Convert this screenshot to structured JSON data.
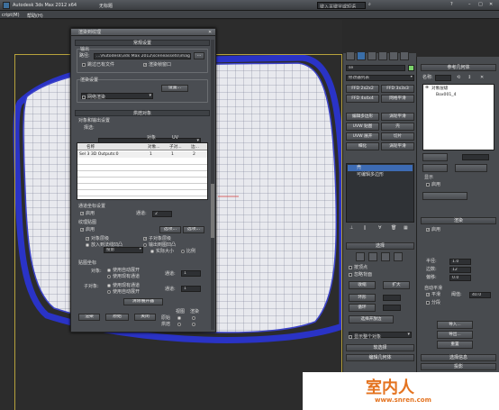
{
  "titlebar": {
    "app_title": "Autodesk 3ds Max  2012 x64",
    "doc_title": "无标题",
    "search_placeholder": "键入关键字或短语"
  },
  "menubar": {
    "items": [
      "cript(M)",
      "帮助(H)"
    ]
  },
  "dialog": {
    "title": "渲染到纹理",
    "general": {
      "header": "常规设置",
      "output_label": "输出",
      "path_label": "路径:",
      "path_value": "...\\Autodesk\\3ds Max 2012\\sceneassets\\images\\",
      "browse_label": "...",
      "skip_existing": "跳过已有文件",
      "show_frame_window": "渲染帧窗口",
      "render_settings_label": "渲染设置",
      "preset_value": "",
      "setup_button": "设置...",
      "network_render": "网络渲染"
    },
    "baked_object": {
      "header": "烘焙对象",
      "projection_label": "对象和输出设置",
      "selection_label": "择选:",
      "columns": [
        "名称",
        "对象...",
        "子对...",
        "边..."
      ],
      "subheaders": [
        "对象",
        "UV"
      ],
      "row": [
        "Sel 3 3D Outputs:0",
        "1",
        "1",
        "2"
      ]
    },
    "mapping": {
      "channel_label": "通道坐标设置",
      "enable": "启用",
      "channel_name": "通道:",
      "channel_value": "2",
      "auto_unwrap_label": "纹理贴图",
      "use_existing": "启用",
      "projection_value": "投影",
      "options_button": "选项...",
      "options_button2": "选项...",
      "object_level": "对象层级",
      "sub_object_level": "子对象层级",
      "put_to_normal": "放入到法线凹凸",
      "put_to_bump": "输出到图凹凸",
      "actual_size": "实际大小",
      "proportional": "比例"
    },
    "render": {
      "header": "贴图坐标",
      "object_label": "对象:",
      "sub_object_label": "子对象:",
      "use_auto_unwrap": "使用自动展开",
      "use_existing_channel": "使用现有通道",
      "use_existing_channel2": "使用现有通道",
      "use_auto_unwrap2": "使用自动展开",
      "channel_label": "通道:",
      "channel_value": "1",
      "clear_unwrap_button": "清除展开器",
      "render_button": "渲染",
      "original_button": "原始",
      "close_button": "关闭",
      "views_label": "视图",
      "render_label": "渲染",
      "original_label": "原始",
      "baked_label": "烘焙"
    }
  },
  "command_panel": {
    "object_name": "se",
    "modifier_list": "修改器列表",
    "buttons": [
      "FFD 2x2x2",
      "FFD 3x3x3",
      "FFD 4x4x4",
      "网格平滑",
      "编辑多边形",
      "涡轮平滑",
      "UVW 贴图",
      "壳",
      "UVW 展开",
      "切片",
      "细化",
      "涡轮平滑"
    ],
    "stack": [
      "壳",
      "可编辑多边形"
    ],
    "section_selection": "选择",
    "by_vertex": "按顶点",
    "ignore_backface": "忽略背面",
    "shrink_button": "收缩",
    "grow_button": "扩大",
    "ring_button": "环形",
    "loop_button": "循环",
    "select_open_edges": "选择开放边",
    "soft_selection": "软选择",
    "whole_object": "显示整个对象",
    "edit_geometry": "编辑几何体"
  },
  "nameplate": {
    "header": "参考几何体",
    "name_label": "名称:",
    "name_value": "",
    "tree_item1": "对象层级",
    "tree_item2": "Box001_4",
    "section_display": "显示",
    "section_render": "渲染",
    "enable_label": "启用",
    "radius_label": "半径:",
    "radius_value": "1.0",
    "sides_label": "边数:",
    "sides_value": "12",
    "offset_label": "偏移:",
    "offset_value": "0.0",
    "smooth_label": "平滑",
    "tile_label": "分段",
    "auto_smooth": "自动平滑",
    "threshold_label": "阈值:",
    "threshold_value": "40.0",
    "import_button": "导入...",
    "export_button": "导出...",
    "reset_button": "重置",
    "bottom_headers": [
      "选择信息",
      "投影"
    ]
  },
  "watermark": {
    "brand": "室内人",
    "url": "www.snren.com"
  }
}
